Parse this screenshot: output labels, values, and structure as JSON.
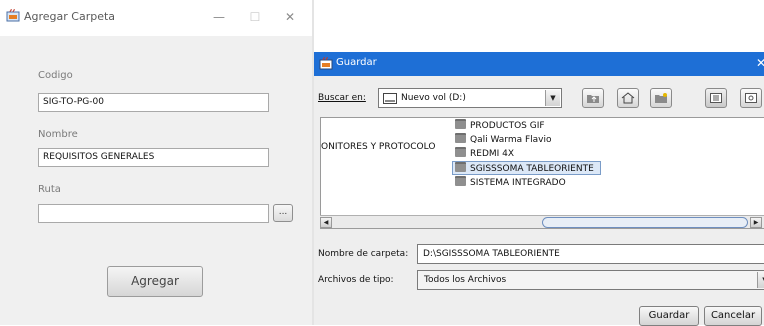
{
  "agregar_window": {
    "title": "Agregar Carpeta",
    "controls": {
      "minimize": "—",
      "maximize": "☐",
      "close": "✕"
    },
    "codigo_label": "Codigo",
    "codigo_value": "SIG-TO-PG-00",
    "nombre_label": "Nombre",
    "nombre_value": "REQUISITOS GENERALES",
    "ruta_label": "Ruta",
    "ruta_value": "",
    "browse_label": "...",
    "agregar_label": "Agregar"
  },
  "guardar_dialog": {
    "title": "Guardar",
    "close": "✕",
    "buscar_en_label": "Buscar en:",
    "buscar_en_value": "Nuevo vol (D:)",
    "toolbar_icons": [
      "up-folder-icon",
      "home-icon",
      "new-folder-icon",
      "list-view-icon",
      "details-view-icon"
    ],
    "left_column_item": "ONITORES Y PROTOCOLO",
    "folders": [
      "PRODUCTOS GIF",
      "Qali Warma Flavio",
      "REDMI 4X",
      "SGISSSOMA TABLEORIENTE",
      "SISTEMA INTEGRADO"
    ],
    "selected_folder_index": 3,
    "nombre_carpeta_label": "Nombre de carpeta:",
    "nombre_carpeta_value": "D:\\SGISSSOMA TABLEORIENTE",
    "archivos_tipo_label": "Archivos de tipo:",
    "archivos_tipo_value": "Todos los Archivos",
    "guardar_button": "Guardar",
    "cancelar_button": "Cancelar"
  },
  "colors": {
    "title_bar_blue": "#1e6fd6",
    "selection": "#dce8f7"
  }
}
